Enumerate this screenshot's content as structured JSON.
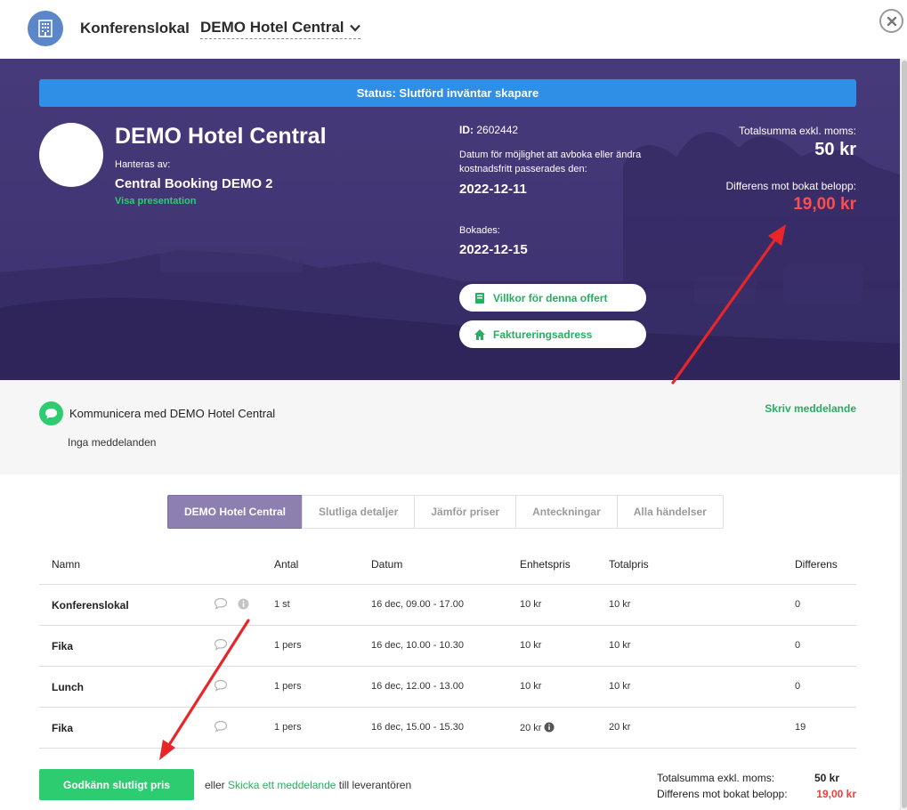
{
  "header": {
    "title": "Konferenslokal",
    "venue_select": "DEMO Hotel Central",
    "icons": {
      "hotel": "hotel-icon",
      "close": "close-icon",
      "chevron": "chevron-down-icon"
    }
  },
  "hero": {
    "status": "Status: Slutförd inväntar skapare",
    "venue_name": "DEMO Hotel Central",
    "managed_label": "Hanteras av:",
    "managed_by": "Central Booking DEMO 2",
    "presentation_link": "Visa presentation",
    "id_label": "ID:",
    "id_value": "2602442",
    "cancel_text": "Datum för möjlighet att avboka eller ändra kostnadsfritt passerades den:",
    "cancel_date": "2022-12-11",
    "booked_label": "Bokades:",
    "booked_date": "2022-12-15",
    "terms_button": "Villkor för denna offert",
    "invoice_button": "Faktureringsadress",
    "total_label": "Totalsumma exkl. moms:",
    "total_value": "50 kr",
    "diff_label": "Differens mot bokat belopp:",
    "diff_value": "19,00 kr"
  },
  "communication": {
    "title": "Kommunicera med DEMO Hotel Central",
    "empty": "Inga meddelanden",
    "write": "Skriv meddelande"
  },
  "tabs": [
    "DEMO Hotel Central",
    "Slutliga detaljer",
    "Jämför priser",
    "Anteckningar",
    "Alla händelser"
  ],
  "table": {
    "headers": [
      "Namn",
      "Antal",
      "Datum",
      "Enhetspris",
      "Totalpris",
      "Differens"
    ],
    "rows": [
      {
        "name": "Konferenslokal",
        "qty": "1 st",
        "date": "16 dec, 09.00 - 17.00",
        "unit": "10 kr",
        "total": "10 kr",
        "diff": "0"
      },
      {
        "name": "Fika",
        "qty": "1 pers",
        "date": "16 dec, 10.00 - 10.30",
        "unit": "10 kr",
        "total": "10 kr",
        "diff": "0"
      },
      {
        "name": "Lunch",
        "qty": "1 pers",
        "date": "16 dec, 12.00 - 13.00",
        "unit": "10 kr",
        "total": "10 kr",
        "diff": "0"
      },
      {
        "name": "Fika",
        "qty": "1 pers",
        "date": "16 dec, 15.00 - 15.30",
        "unit": "20 kr",
        "total": "20 kr",
        "diff": "19"
      }
    ]
  },
  "footer": {
    "approve_button": "Godkänn slutligt pris",
    "text_before": "eller",
    "link": "Skicka ett meddelande",
    "text_after": "till leverantören",
    "total_label": "Totalsumma exkl. moms:",
    "total_value": "50 kr",
    "diff_label": "Differens mot bokat belopp:",
    "diff_value": "19,00 kr"
  },
  "colors": {
    "accent_green": "#2ecc71",
    "status_blue": "#2f8fe6",
    "hero_purple": "#3f3270",
    "diff_red": "#e8413e",
    "tab_active": "#8d80b0"
  }
}
